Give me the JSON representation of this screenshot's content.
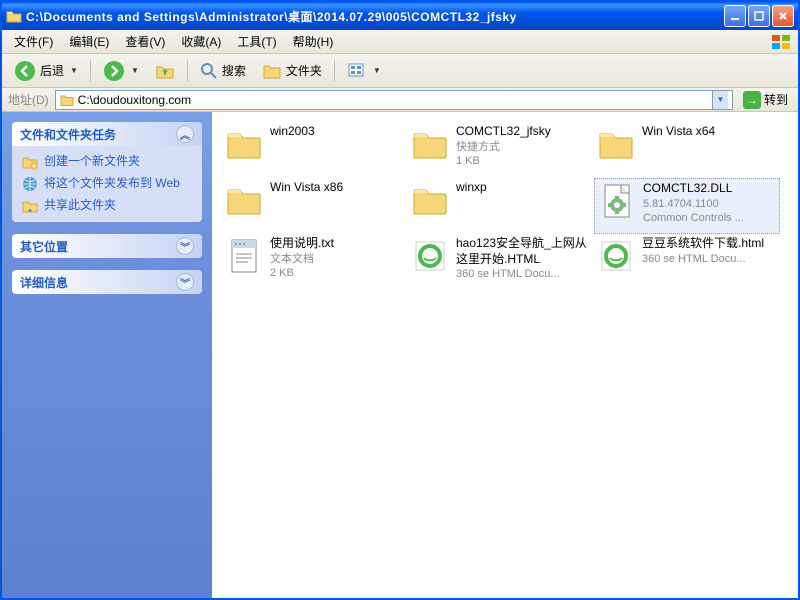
{
  "titlebar": {
    "path": "C:\\Documents and Settings\\Administrator\\桌面\\2014.07.29\\005\\COMCTL32_jfsky"
  },
  "menu": {
    "file": "文件(F)",
    "edit": "编辑(E)",
    "view": "查看(V)",
    "favorites": "收藏(A)",
    "tools": "工具(T)",
    "help": "帮助(H)"
  },
  "toolbar": {
    "back": "后退",
    "search": "搜索",
    "folders": "文件夹"
  },
  "addressbar": {
    "label": "地址(D)",
    "value": "C:\\doudouxitong.com",
    "go": "转到"
  },
  "sidebar": {
    "panel1": {
      "title": "文件和文件夹任务",
      "tasks": [
        "创建一个新文件夹",
        "将这个文件夹发布到 Web",
        "共享此文件夹"
      ]
    },
    "panel2": {
      "title": "其它位置"
    },
    "panel3": {
      "title": "详细信息"
    }
  },
  "files": [
    {
      "name": "win2003",
      "type": "folder",
      "desc": "",
      "desc2": ""
    },
    {
      "name": "COMCTL32_jfsky",
      "type": "folder",
      "desc": "快捷方式",
      "desc2": "1 KB"
    },
    {
      "name": "Win Vista x64",
      "type": "folder",
      "desc": "",
      "desc2": ""
    },
    {
      "name": "Win Vista x86",
      "type": "folder",
      "desc": "",
      "desc2": ""
    },
    {
      "name": "winxp",
      "type": "folder",
      "desc": "",
      "desc2": ""
    },
    {
      "name": "COMCTL32.DLL",
      "type": "dll",
      "desc": "5.81.4704.1100",
      "desc2": "Common Controls ...",
      "selected": true
    },
    {
      "name": "使用说明.txt",
      "type": "txt",
      "desc": "文本文档",
      "desc2": "2 KB"
    },
    {
      "name": "hao123安全导航_上网从这里开始.HTML",
      "type": "html",
      "desc": "360 se HTML Docu...",
      "desc2": ""
    },
    {
      "name": "豆豆系统软件下载.html",
      "type": "html",
      "desc": "360 se HTML Docu...",
      "desc2": ""
    }
  ]
}
